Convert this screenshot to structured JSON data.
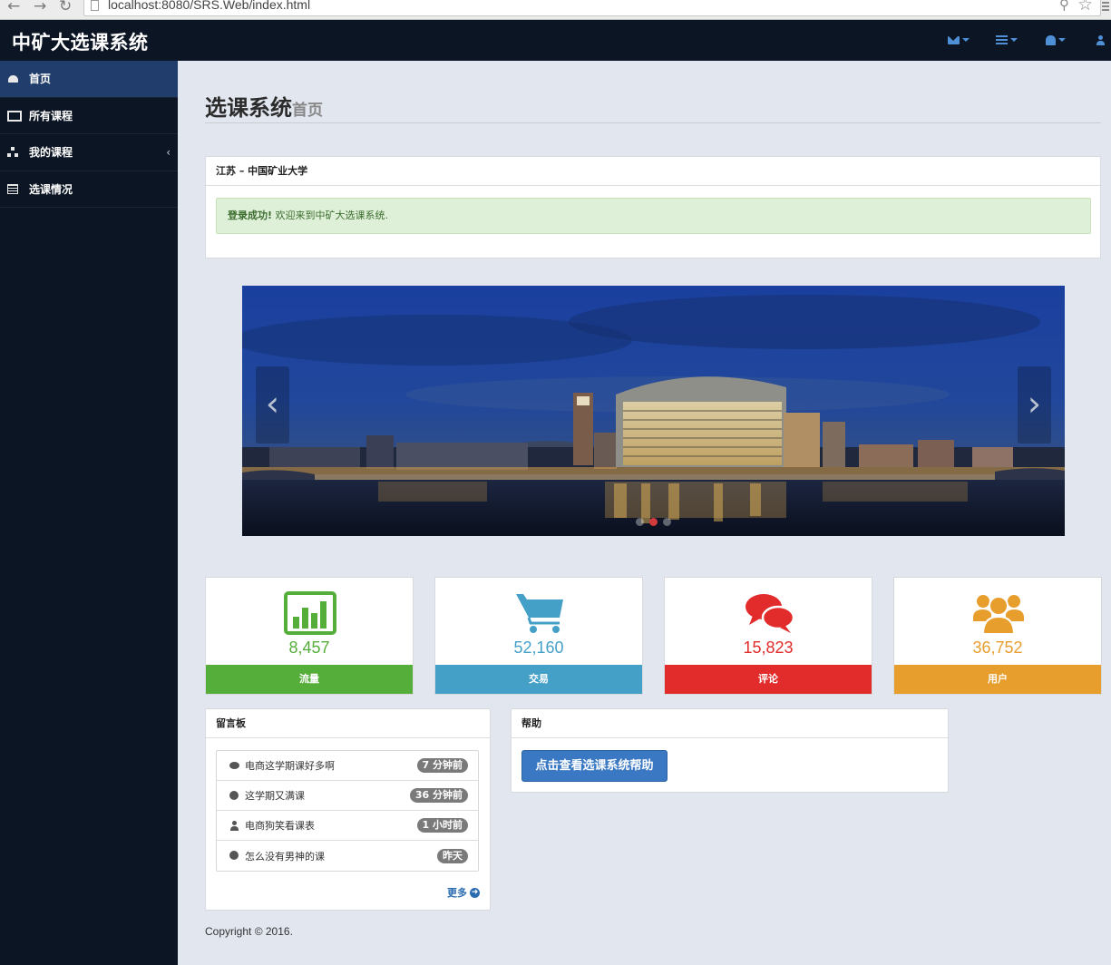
{
  "browser": {
    "url": "localhost:8080/SRS.Web/index.html"
  },
  "header": {
    "brand": "中矿大选课系统",
    "icons": [
      "envelope-icon",
      "tasks-icon",
      "bell-icon",
      "user-icon"
    ]
  },
  "sidebar": {
    "items": [
      {
        "label": "首页",
        "icon": "dashboard-icon",
        "active": true
      },
      {
        "label": "所有课程",
        "icon": "monitor-icon"
      },
      {
        "label": "我的课程",
        "icon": "sitemap-icon",
        "has_submenu": true
      },
      {
        "label": "选课情况",
        "icon": "table-icon"
      }
    ]
  },
  "page": {
    "title": "选课系统",
    "subtitle": "首页"
  },
  "welcome_panel": {
    "heading": "江苏 – 中国矿业大学",
    "alert_strong": "登录成功!",
    "alert_text": " 欢迎来到中矿大选课系统."
  },
  "carousel": {
    "prev": "‹",
    "next": "›",
    "slide_count": 3,
    "active_slide": 1
  },
  "stats": [
    {
      "value": "8,457",
      "label": "流量",
      "icon": "bar-chart-icon",
      "color": "#56ae3a"
    },
    {
      "value": "52,160",
      "label": "交易",
      "icon": "shopping-cart-icon",
      "color": "#45a0c8"
    },
    {
      "value": "15,823",
      "label": "评论",
      "icon": "comments-icon",
      "color": "#e22b2b"
    },
    {
      "value": "36,752",
      "label": "用户",
      "icon": "users-icon",
      "color": "#e89e2c"
    }
  ],
  "message_board": {
    "heading": "留言板",
    "items": [
      {
        "text": "电商这学期课好多啊",
        "time": "7 分钟前",
        "icon": "comment-icon"
      },
      {
        "text": "这学期又满课",
        "time": "36 分钟前",
        "icon": "globe-icon"
      },
      {
        "text": "电商狗笑看课表",
        "time": "1 小时前",
        "icon": "user-icon"
      },
      {
        "text": "怎么没有男神的课",
        "time": "昨天",
        "icon": "globe-icon"
      }
    ],
    "more": "更多"
  },
  "help_panel": {
    "heading": "帮助",
    "button": "点击查看选课系统帮助"
  },
  "footer": {
    "copyright": "Copyright © 2016."
  }
}
